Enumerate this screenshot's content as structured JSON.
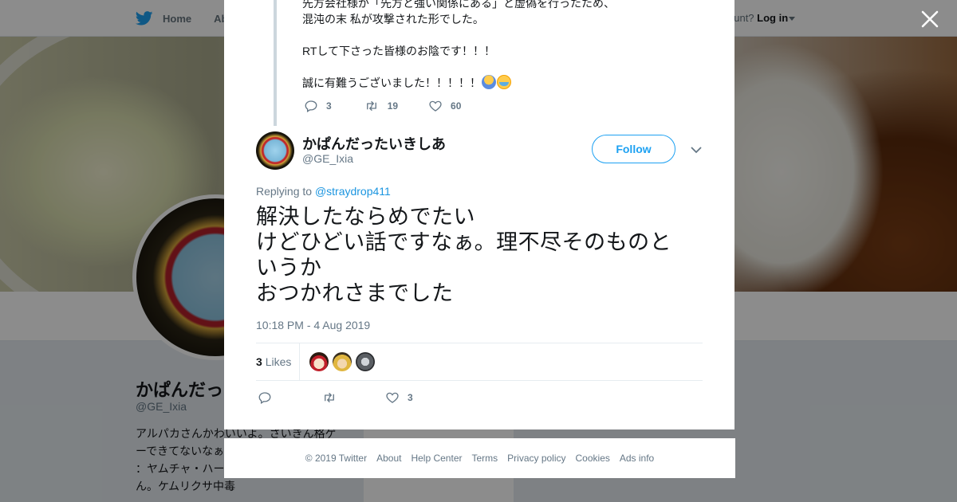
{
  "background": {
    "nav": {
      "home": "Home",
      "about_partial": "Abo"
    },
    "login": {
      "prompt_partial": "ccount?",
      "link": "Log in"
    },
    "profile": {
      "name_partial": "かぱんだっ",
      "handle": "@GE_Ixia",
      "bio_partial": "アルパカさんかわいいよ。さいきん格ゲ ーできてないなぁ と！：アルパカ ト ーズ ：ヤムチャ・ハーメック・ビーデル さん。ケムリクサ中毒"
    },
    "card_partial": "Ads info"
  },
  "modal": {
    "parent_tweet": {
      "text": "先方会社様が「先方と強い関係にある」と虚偽を行ったため、\n混沌の末 私が攻撃された形でした。\n\nRTして下さった皆様のお陰です！！！\n\n誠に有難うございました！！！！！",
      "replies": "3",
      "retweets": "19",
      "likes": "60"
    },
    "tweet": {
      "author_name": "かぱんだったいきしあ",
      "author_handle": "@GE_Ixia",
      "follow_label": "Follow",
      "replying_prefix": "Replying to",
      "replying_handle": "@straydrop411",
      "text": "解決したならめでたい\nけどひどい話ですなぁ。理不尽そのものと\nいうか\nおつかれさまでした",
      "timestamp": "10:18 PM - 4 Aug 2019",
      "likes_count": "3",
      "likes_label": "Likes",
      "like_action_count": "3"
    }
  },
  "footer": {
    "links": [
      "© 2019 Twitter",
      "About",
      "Help Center",
      "Terms",
      "Privacy policy",
      "Cookies",
      "Ads info"
    ]
  },
  "colors": {
    "accent": "#1da1f2",
    "link": "#1b95e0",
    "muted": "#657786",
    "overlay": "rgba(0,0,0,0.45)"
  },
  "icons": [
    "twitter-bird-icon",
    "close-icon",
    "reply-icon",
    "retweet-icon",
    "like-icon",
    "chevron-down-icon"
  ]
}
